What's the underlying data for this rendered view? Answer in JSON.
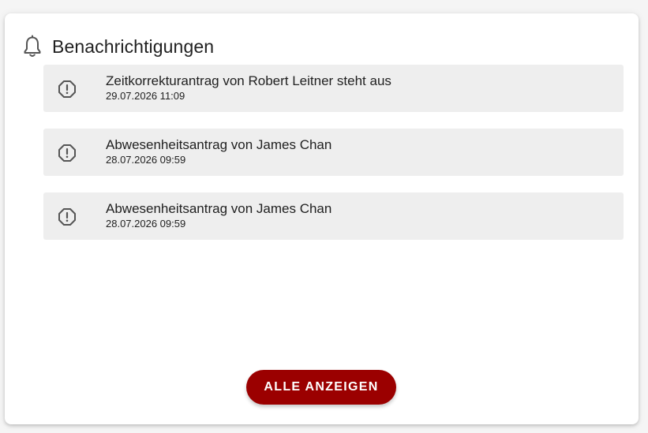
{
  "notifications": {
    "title": "Benachrichtigungen",
    "header_icon": "bell-icon",
    "item_icon": "alert-octagon-icon",
    "items": [
      {
        "message": "Zeitkorrekturantrag von Robert Leitner steht aus",
        "timestamp": "29.07.2026 11:09"
      },
      {
        "message": "Abwesenheitsantrag von James Chan",
        "timestamp": "28.07.2026 09:59"
      },
      {
        "message": "Abwesenheitsantrag von James Chan",
        "timestamp": "28.07.2026 09:59"
      }
    ],
    "show_all_label": "ALLE ANZEIGEN"
  },
  "colors": {
    "accent": "#9b0000",
    "item_background": "#eeeeee",
    "icon": "#555555"
  }
}
